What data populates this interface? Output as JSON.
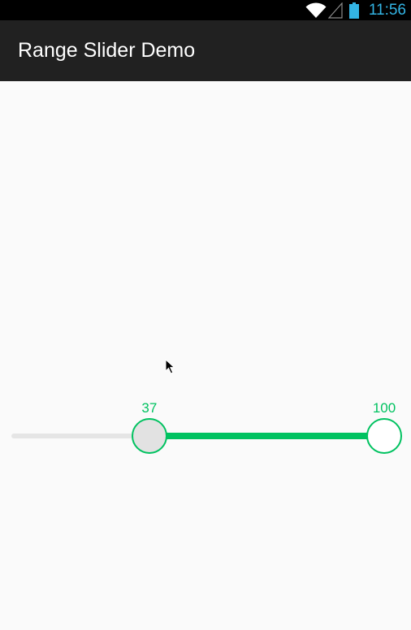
{
  "status_bar": {
    "time": "11:56",
    "icons": [
      "wifi-icon",
      "signal-icon",
      "battery-icon"
    ],
    "clock_color": "#33b5e5"
  },
  "action_bar": {
    "title": "Range Slider Demo"
  },
  "range_slider": {
    "min": 0,
    "max": 100,
    "selected_min": 37,
    "selected_max": 100,
    "min_label": "37",
    "max_label": "100",
    "accent_color": "#00c260",
    "track_color": "#e5e5e5"
  }
}
